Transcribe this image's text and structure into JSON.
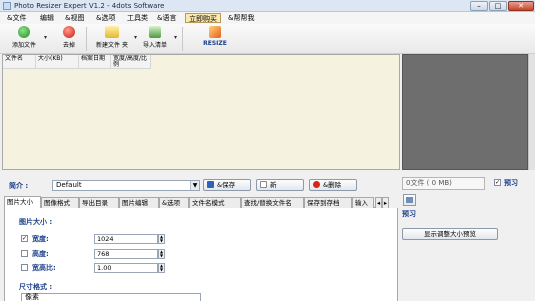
{
  "window": {
    "title": "Photo Resizer Expert V1.2 - 4dots Software",
    "minimize": "–",
    "maximize": "□",
    "close": "✕"
  },
  "menu": [
    "&文件",
    "编辑",
    "&视图",
    "&选项",
    "工具类",
    "&语言",
    "立即购买",
    "&帮帮我"
  ],
  "menu_active_index": 6,
  "toolbar": {
    "add_file": "添加文件",
    "remove": "去掉",
    "add_folder": "新建文件 夹",
    "import_list": "导入清单",
    "resize": "RESIZE",
    "dropdown_glyph": "▾"
  },
  "columns": [
    "文件名",
    "大小(KB)",
    "档案日期",
    "宽度/高度/比例"
  ],
  "profile": {
    "label": "简介 :",
    "value": "Default",
    "save": "&保存",
    "new": "新",
    "delete": "&删除"
  },
  "tabs": [
    "图片大小",
    "图像格式",
    "导出目录",
    "图片编辑",
    "&选项",
    "文件名模式",
    "查找/替换文件名",
    "保存到存档",
    "输入"
  ],
  "tab_selected_index": 0,
  "tab_scroll": {
    "left": "◂",
    "right": "▸"
  },
  "image_size": {
    "heading": "图片大小 :",
    "width_label": "宽度:",
    "width_checked": true,
    "width_value": "1024",
    "height_label": "高度:",
    "height_checked": false,
    "height_value": "768",
    "ratio_label": "宽高比:",
    "ratio_checked": false,
    "ratio_value": "1.00",
    "size_format_heading": "尺寸格式 :",
    "size_format_value": "像素"
  },
  "side": {
    "file_count": "0文件 ( 0 MB)",
    "preview_checkbox": "预习",
    "preview_checked": true,
    "preview_label": "预习",
    "show_sizes_button": "显示调整大小预览"
  },
  "colors": {
    "accent": "#1a3f8a",
    "list_bg": "#f5f2e0",
    "preview_bg": "#6e6e6e"
  }
}
